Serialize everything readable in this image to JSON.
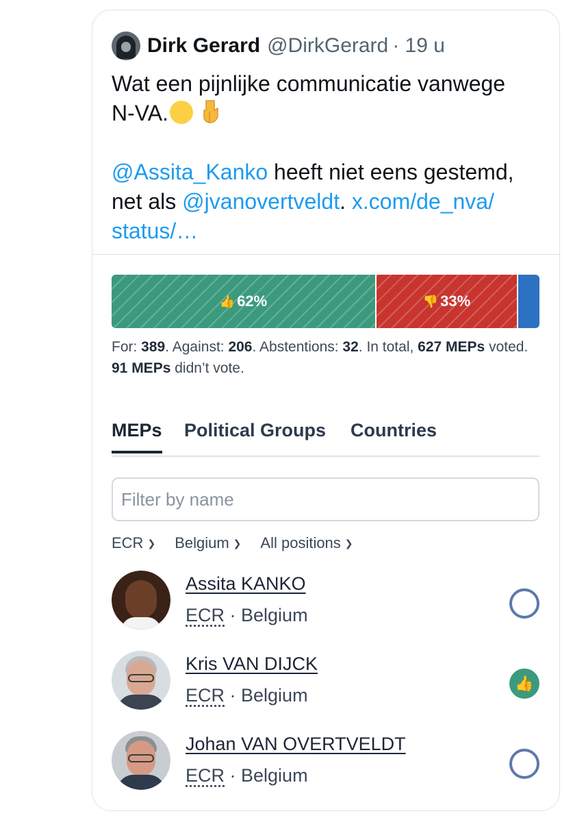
{
  "tweet": {
    "author_name": "Dirk Gerard",
    "author_handle": "@DirkGerard",
    "time": "· 19 u",
    "line1": "Wat een pijnlijke communicatie vanwege",
    "line2": "N-VA.",
    "mention1": "@Assita_Kanko",
    "text_after_mention1": " heeft niet eens gestemd,",
    "line4_prefix": "net als ",
    "mention2": "@jvanovertveldt",
    "text_after_mention2": ". ",
    "link": "x.com/de_nva/",
    "link2": "status/…"
  },
  "vote_bar": {
    "for_label": "62%",
    "against_label": "33%",
    "for_fraction": 0.62,
    "against_fraction": 0.33,
    "abstention_fraction": 0.05,
    "colors": {
      "for": "#3b9a7d",
      "against": "#c8342e",
      "abstentions": "#2c72c2"
    }
  },
  "summary": {
    "for_label": "For: ",
    "for_count": "389",
    "against_label": ". Against: ",
    "against_count": "206",
    "abst_label": ". Abstentions: ",
    "abst_count": "32",
    "total_label": ". In total, ",
    "total_count": "627 MEPs",
    "voted_label": " voted. ",
    "not_voted_count": "91 MEPs",
    "not_voted_label": " didn’t vote."
  },
  "tabs": [
    {
      "label": "MEPs",
      "active": true
    },
    {
      "label": "Political Groups",
      "active": false
    },
    {
      "label": "Countries",
      "active": false
    }
  ],
  "filter": {
    "placeholder": "Filter by name",
    "value": ""
  },
  "dropdowns": [
    {
      "value": "ECR"
    },
    {
      "value": "Belgium"
    },
    {
      "value": "All positions"
    }
  ],
  "meps": [
    {
      "name": "Assita KANKO",
      "group": "ECR",
      "country": "Belgium",
      "separator": " · ",
      "vote": "did not vote"
    },
    {
      "name": "Kris VAN DIJCK",
      "group": "ECR",
      "country": "Belgium",
      "separator": " · ",
      "vote": "for"
    },
    {
      "name": "Johan VAN OVERTVELDT",
      "group": "ECR",
      "country": "Belgium",
      "separator": " · ",
      "vote": "did not vote"
    }
  ]
}
